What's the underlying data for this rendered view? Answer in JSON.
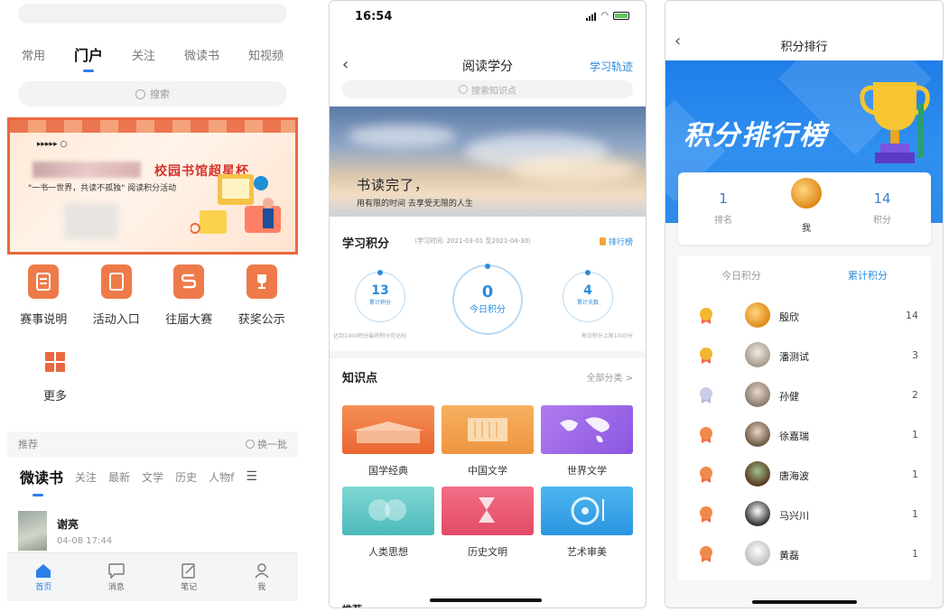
{
  "panel1": {
    "tabs": [
      "常用",
      "门户",
      "关注",
      "微读书",
      "知视频"
    ],
    "active_tab": "门户",
    "search_placeholder": "搜索",
    "banner": {
      "title": "校园书馆超星杯",
      "subtitle": "\"一书一世界，共读不孤独\" 阅读积分活动"
    },
    "grid": [
      {
        "label": "赛事说明",
        "icon": "document-icon"
      },
      {
        "label": "活动入口",
        "icon": "entrance-icon"
      },
      {
        "label": "往届大赛",
        "icon": "s-icon"
      },
      {
        "label": "获奖公示",
        "icon": "trophy-icon"
      }
    ],
    "more_label": "更多",
    "recommend": {
      "label": "推荐",
      "refresh": "换一批"
    },
    "categories": [
      "微读书",
      "关注",
      "最新",
      "文学",
      "历史",
      "人物f"
    ],
    "feed_item": {
      "name": "谢亮",
      "time": "04-08 17:44"
    },
    "nav": [
      {
        "label": "首页",
        "icon": "home-icon",
        "active": true
      },
      {
        "label": "消息",
        "icon": "message-icon",
        "active": false
      },
      {
        "label": "笔记",
        "icon": "note-icon",
        "active": false
      },
      {
        "label": "我",
        "icon": "user-icon",
        "active": false
      }
    ],
    "accent_color": "#2b7fe8",
    "brand_color": "#e9683f"
  },
  "panel2": {
    "status_time": "16:54",
    "title": "阅读学分",
    "track_link": "学习轨迹",
    "search_placeholder": "搜索知识点",
    "hero": {
      "line1": "书读完了，",
      "line2": "用有限的时间 去享受无限的人生"
    },
    "score_title": "学习积分",
    "score_period": "（学习时间: 2021-03-01 至2021-04-30）",
    "rank_link": "排行榜",
    "rings": [
      {
        "value": "13",
        "label": "累计积分"
      },
      {
        "value": "0",
        "label": "今日积分"
      },
      {
        "value": "4",
        "label": "累计天数"
      }
    ],
    "note_left": "达到1400积分最终积分可达标",
    "note_right": "每日积分上限1000分",
    "knowledge_title": "知识点",
    "all_categories": "全部分类 >",
    "cards": [
      {
        "label": "国学经典",
        "color": "#f07a3e"
      },
      {
        "label": "中国文学",
        "color": "#f3a04d"
      },
      {
        "label": "世界文学",
        "color": "#9b6ce6"
      },
      {
        "label": "人类思想",
        "color": "#5fc7c7"
      },
      {
        "label": "历史文明",
        "color": "#ee5c7a"
      },
      {
        "label": "艺术审美",
        "color": "#3aa5e6"
      }
    ],
    "footer_partial": "推荐"
  },
  "panel3": {
    "title": "积分排行",
    "banner_title": "积分排行榜",
    "rank": {
      "value": "1",
      "label": "排名"
    },
    "me_label": "我",
    "points": {
      "value": "14",
      "label": "积分"
    },
    "tabs": [
      "今日积分",
      "累计积分"
    ],
    "active_tab": "累计积分",
    "rows": [
      {
        "name": "殷欣",
        "score": "14",
        "medal": "gold"
      },
      {
        "name": "潘测试",
        "score": "3",
        "medal": "gold"
      },
      {
        "name": "孙健",
        "score": "2",
        "medal": "silver"
      },
      {
        "name": "徐嘉瑞",
        "score": "1",
        "medal": "bronze"
      },
      {
        "name": "唐海波",
        "score": "1",
        "medal": "bronze"
      },
      {
        "name": "马兴川",
        "score": "1",
        "medal": "bronze"
      },
      {
        "name": "黄磊",
        "score": "1",
        "medal": "bronze"
      }
    ],
    "accent_color": "#2b8ddf"
  }
}
